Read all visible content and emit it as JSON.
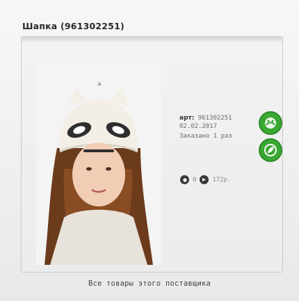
{
  "header": {
    "title": "Шапка (961302251)"
  },
  "product": {
    "art_label": "арт:",
    "art_value": "961302251",
    "date": "02.02.2017",
    "ordered": "Заказано 1 раз"
  },
  "stats": {
    "likes": "0",
    "views": "172р."
  },
  "footer": {
    "all_products_link": "Все товары этого поставщика"
  },
  "colors": {
    "green": "#3aa832",
    "dark_icon": "#3a3a3a"
  },
  "icons": [
    "heart-icon",
    "sticker-icon",
    "leaf-icon",
    "comment-icon",
    "eye-icon"
  ]
}
